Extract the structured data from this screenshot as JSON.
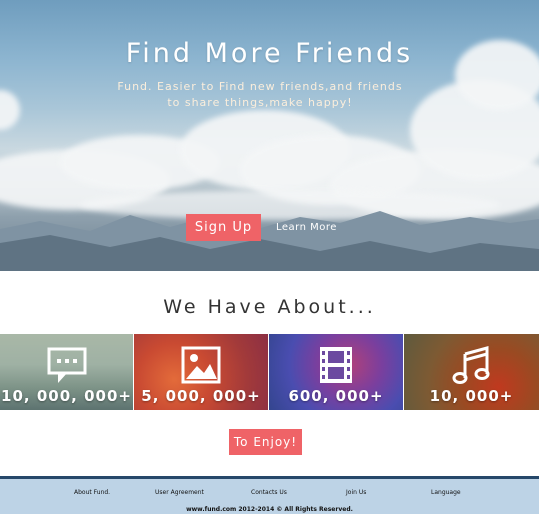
{
  "hero": {
    "title": "Find More Friends",
    "subtitle_line1": "Fund. Easier to Find new friends,and friends",
    "subtitle_line2": "to share things,make happy!",
    "signup_label": "Sign Up",
    "learn_more_label": "Learn More"
  },
  "stats": {
    "title": "We Have About...",
    "tiles": [
      {
        "icon": "chat-bubble-icon",
        "value": "10, 000, 000+"
      },
      {
        "icon": "picture-icon",
        "value": "5, 000, 000+"
      },
      {
        "icon": "film-icon",
        "value": "600, 000+"
      },
      {
        "icon": "music-note-icon",
        "value": "10, 000+"
      }
    ]
  },
  "cta": {
    "label": "To Enjoy!"
  },
  "footer": {
    "links": [
      "About Fund.",
      "User Agreement",
      "Contacts Us",
      "Join Us",
      "Language"
    ],
    "copyright": "www.fund.com  2012-2014  © All Rights Reserved."
  },
  "colors": {
    "accent": "#ef6367",
    "footer_bg": "#bdd3e6",
    "footer_border": "#26486a"
  }
}
